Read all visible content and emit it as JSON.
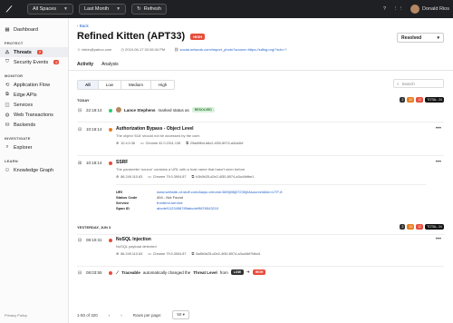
{
  "topbar": {
    "space": "All Spaces",
    "range": "Last Month",
    "refresh": "Refresh",
    "user": "Donald Rios"
  },
  "sidebar": {
    "dashboard": "Dashboard",
    "sec_protect": "PROTECT",
    "threats": "Threats",
    "threats_count": "7",
    "security_events": "Security Events",
    "security_events_count": "6",
    "sec_monitor": "MONITOR",
    "application_flow": "Application Flow",
    "edge_apis": "Edge APIs",
    "services": "Services",
    "web_transactions": "Web Transactions",
    "backends": "Backends",
    "sec_investigate": "INVESTIGATE",
    "explorer": "Explorer",
    "sec_learn": "LEARN",
    "knowledge_graph": "Knowledge Graph",
    "footer": "Privacy Policy"
  },
  "header": {
    "back": "Back",
    "title": "Refined Kitten (APT33)",
    "severity": "HIGH",
    "status": "Resolved",
    "actor": "rklein@yahoo.com",
    "date": "2019-06-17 02:06:34 PM",
    "url": "social-network.com/import_photo?source=https://sdfsg.org/?sdv=?"
  },
  "tabs": [
    "Activity",
    "Analysis"
  ],
  "filters": [
    "All",
    "Low",
    "Medium",
    "High"
  ],
  "search_placeholder": "Search",
  "today": {
    "label": "TODAY",
    "counts": [
      "2",
      "10",
      "12"
    ],
    "total": "TOTAL: 24"
  },
  "events": {
    "e1_time": "22:18:14",
    "e1_actor": "Lance Stephens",
    "e1_text": "marked status as",
    "e1_tag": "RESOLVED",
    "e2_time": "10:18:14",
    "e2_title": "Authorization Bypass - Object Level",
    "e2_desc": "The object '618' should not be accessed by the user.",
    "e2_ip": "10.4.0.36",
    "e2_browser": "Chrome 42.0.2311.135",
    "e2_id": "29ad5fbd-d8c2-4f30-8974-a3cd4bf",
    "e3_time": "10:18:14",
    "e3_title": "SSRF",
    "e3_desc": "The parameter 'source' contains a URL with a host name that hasn't seen before",
    "e3_ip": "86.249.110.63",
    "e3_browser": "Chrome 79.0.3904.87",
    "e3_id": "b3b0b25-d2e2-4f30-8974-a3cd4bfbe1",
    "e3_k_uri": "URI",
    "e3_v_uri": "www.website-of-stuff.com/&aqs=chrome.6l69j0l6j57230j0&sourceid&ie=UTF-8",
    "e3_k_status": "Status Code",
    "e3_v_status": "404 - Not Found",
    "e3_k_service": "Service",
    "e3_v_service": "frontend-service",
    "e3_k_span": "Span ID",
    "e3_v_span": "abcdef1123456789abcdef9876543210"
  },
  "yesterday": {
    "label": "YESTERDAY, JUN 3",
    "counts": [
      "2",
      "10",
      "12"
    ],
    "total": "TOTAL: 24",
    "e4_time": "08:10:31",
    "e4_title": "NoSQL Injection",
    "e4_desc": "NoSQL payload detected",
    "e4_ip": "86.249.110.63",
    "e4_browser": "Chrome 79.0.3904.87",
    "e4_id": "5a8b0b25-d2e2-4f30-8974-a3cd4bf7f4bd1",
    "e5_time": "08:03:55",
    "e5_actor": "Traceable",
    "e5_text": "automatically changed the",
    "e5_field": "Threat Level",
    "e5_from_word": "from",
    "e5_from": "LOW",
    "e5_to": "HIGH"
  },
  "pagination": {
    "range": "1-50 of 320",
    "rows_label": "Rows per page:",
    "rows_value": "50"
  },
  "colors": {
    "accent": "#2563c9",
    "high": "#e74c3c",
    "dark": "#1f2023"
  }
}
